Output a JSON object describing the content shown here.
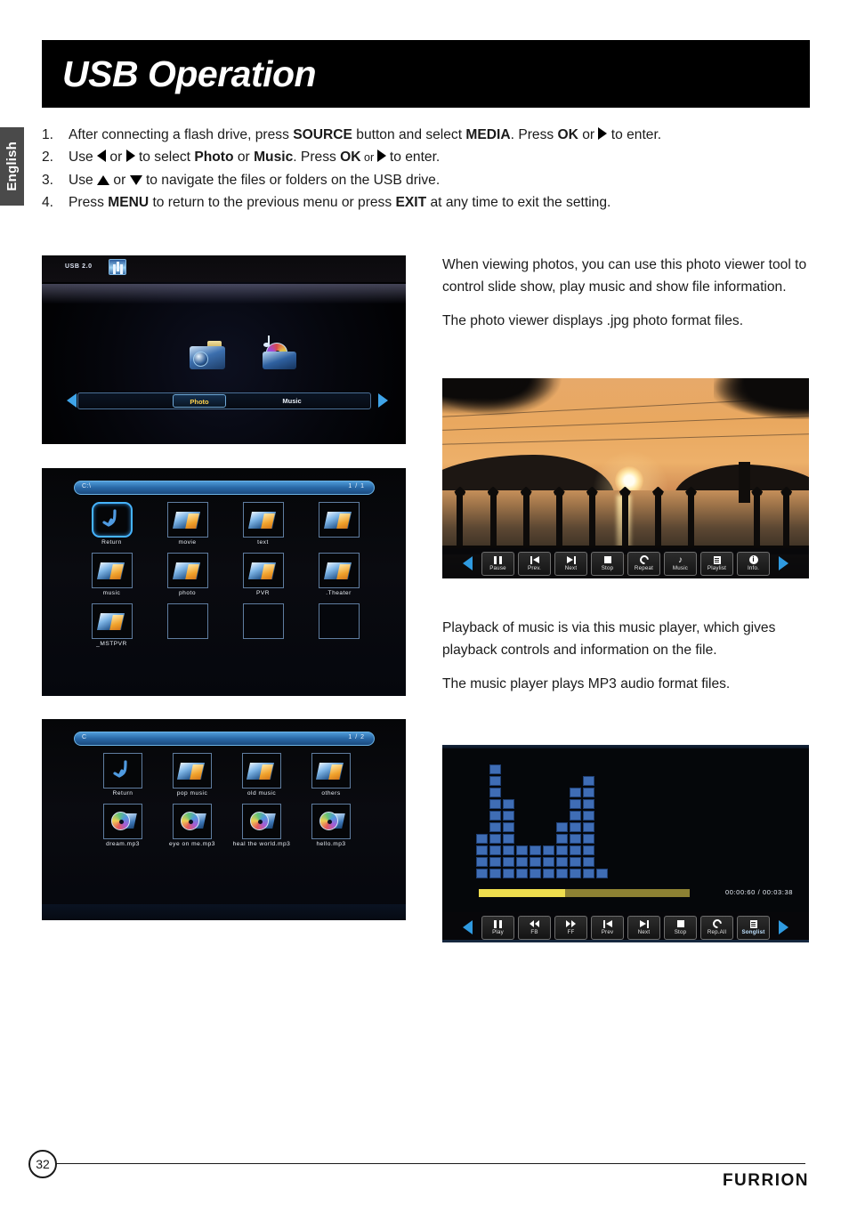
{
  "sidebar": {
    "language_tab": "English"
  },
  "header": {
    "title": "USB Operation"
  },
  "steps": [
    {
      "num": "1.",
      "pre": "After connecting a flash drive, press ",
      "b1": "SOURCE",
      "mid1": " button and select ",
      "b2": "MEDIA",
      "mid2": ". Press ",
      "b3": "OK",
      "mid3": " or ",
      "icon": "triangle-right-icon",
      "post": " to enter."
    },
    {
      "num": "2.",
      "pre": "Use ",
      "icon_left": "triangle-left-icon",
      "mid0": " or ",
      "icon_right": "triangle-right-icon",
      "mid1": " to select ",
      "b1": "Photo",
      "mid2": " or ",
      "b2": "Music",
      "mid3": ". Press ",
      "b3": "OK",
      "mid4": " or ",
      "post": " to enter."
    },
    {
      "num": "3.",
      "pre": "Use ",
      "icon_up": "triangle-up-icon",
      "mid1": " or ",
      "icon_down": "triangle-down-icon",
      "post": " to navigate the files or folders on the USB drive."
    },
    {
      "num": "4.",
      "pre": "Press ",
      "b1": "MENU",
      "mid1": " to return to the previous menu or press ",
      "b2": "EXIT",
      "post": " at any time to exit the setting."
    }
  ],
  "source_screen": {
    "usb_label": "USB 2.0",
    "usb_icon": "usb-drive-icon",
    "options": [
      {
        "label": "Photo",
        "icon": "camera-icon",
        "selected": true
      },
      {
        "label": "Music",
        "icon": "music-disc-icon",
        "selected": false
      }
    ],
    "nav_left_icon": "arrow-left-icon",
    "nav_right_icon": "arrow-right-icon"
  },
  "file_browser": {
    "path": "C:\\",
    "page": "1 / 1",
    "items": [
      {
        "label": "Return",
        "icon": "return-arrow-icon",
        "selected": true
      },
      {
        "label": "movie",
        "icon": "folder-icon"
      },
      {
        "label": "text",
        "icon": "folder-icon"
      },
      {
        "label": "",
        "icon": "folder-icon"
      },
      {
        "label": "music",
        "icon": "folder-icon"
      },
      {
        "label": "photo",
        "icon": "folder-icon"
      },
      {
        "label": "PVR",
        "icon": "folder-icon"
      },
      {
        "label": ".Theater",
        "icon": "folder-icon"
      },
      {
        "label": "_MSTPVR",
        "icon": "folder-icon"
      },
      {
        "label": "",
        "icon": "empty"
      },
      {
        "label": "",
        "icon": "empty"
      },
      {
        "label": "",
        "icon": "empty"
      }
    ]
  },
  "music_browser": {
    "path": "C",
    "page": "1 / 2",
    "items": [
      {
        "label": "Return",
        "icon": "return-arrow-icon"
      },
      {
        "label": "pop music",
        "icon": "folder-icon"
      },
      {
        "label": "old music",
        "icon": "folder-icon"
      },
      {
        "label": "others",
        "icon": "folder-icon"
      },
      {
        "label": "dream.mp3",
        "icon": "mp3-file-icon"
      },
      {
        "label": "eye on me.mp3",
        "icon": "mp3-file-icon"
      },
      {
        "label": "heal the world.mp3",
        "icon": "mp3-file-icon"
      },
      {
        "label": "hello.mp3",
        "icon": "mp3-file-icon"
      }
    ]
  },
  "photo_viewer": {
    "image_caption": "sunset-over-lake-photo",
    "nav_left_icon": "arrow-left-icon",
    "nav_right_icon": "arrow-right-icon",
    "buttons": [
      {
        "label": "Pause",
        "icon": "pause-icon"
      },
      {
        "label": "Prev.",
        "icon": "previous-icon"
      },
      {
        "label": "Next",
        "icon": "next-icon"
      },
      {
        "label": "Stop",
        "icon": "stop-icon"
      },
      {
        "label": "Repeat",
        "icon": "repeat-icon"
      },
      {
        "label": "Music",
        "icon": "music-note-icon"
      },
      {
        "label": "Playlist",
        "icon": "playlist-icon"
      },
      {
        "label": "Info.",
        "icon": "info-icon"
      }
    ]
  },
  "music_player": {
    "time_elapsed": "00:00:60",
    "time_total": "00:03:38",
    "time_display": "00:00:60 / 00:03:38",
    "progress_percent": 41,
    "nav_left_icon": "arrow-left-icon",
    "nav_right_icon": "arrow-right-icon",
    "visualizer_levels": [
      4,
      10,
      7,
      3,
      3,
      3,
      5,
      8,
      9,
      1
    ],
    "buttons": [
      {
        "label": "Play",
        "icon": "pause-icon"
      },
      {
        "label": "FB",
        "icon": "rewind-icon"
      },
      {
        "label": "FF",
        "icon": "fast-forward-icon"
      },
      {
        "label": "Prev",
        "icon": "previous-icon"
      },
      {
        "label": "Next",
        "icon": "next-icon"
      },
      {
        "label": "Stop",
        "icon": "stop-icon"
      },
      {
        "label": "Rep.All",
        "icon": "repeat-icon"
      },
      {
        "label": "Songlist",
        "icon": "playlist-icon",
        "highlighted": true
      }
    ]
  },
  "right_text": {
    "photo_p1": "When viewing photos, you can use this photo viewer tool to control slide show, play music and show file information.",
    "photo_p2": "The photo viewer displays .jpg photo format files.",
    "music_p1": "Playback of music is via this music player, which gives playback controls and information on the file.",
    "music_p2": "The music player plays MP3 audio format files."
  },
  "footer": {
    "page_number": "32",
    "brand": "FURRION"
  },
  "colors": {
    "accent_blue": "#3fa4e8",
    "selected_yellow": "#ffd24a",
    "progress_yellow": "#eedd4e",
    "visualizer_blue": "#3f6db5",
    "tab_gray": "#4a4a4a"
  }
}
